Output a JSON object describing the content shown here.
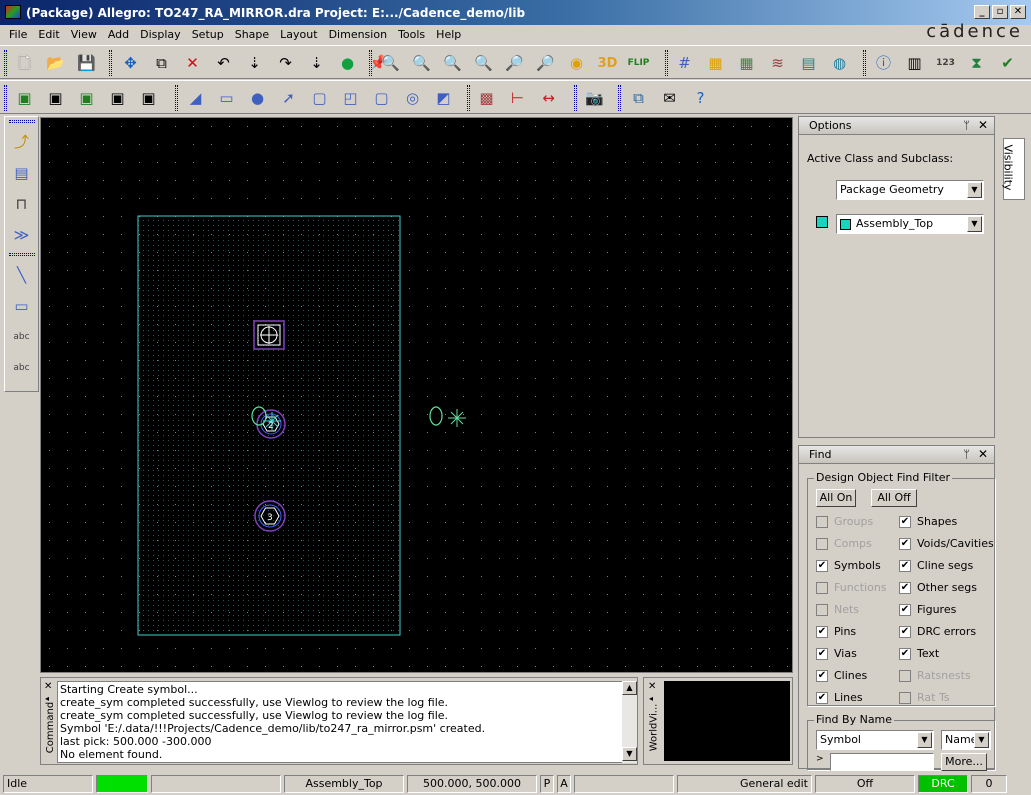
{
  "window": {
    "title": "(Package) Allegro: TO247_RA_MIRROR.dra  Project: E:.../Cadence_demo/lib"
  },
  "brand": "cādence",
  "menu": [
    "File",
    "Edit",
    "View",
    "Add",
    "Display",
    "Setup",
    "Shape",
    "Layout",
    "Dimension",
    "Tools",
    "Help"
  ],
  "canvas_labels": {
    "pin2": "2",
    "pin3": "3"
  },
  "command": {
    "label": "Command",
    "lines": [
      "Starting Create symbol...",
      "create_sym completed successfully, use Viewlog to review the log file.",
      "create_sym completed successfully, use Viewlog to review the log file.",
      "Symbol 'E:/.data/!!!Projects/Cadence_demo/lib/to247_ra_mirror.psm' created.",
      "last pick:  500.000  -300.000",
      "No element found."
    ]
  },
  "worldview": {
    "label": "WorldVi..."
  },
  "options": {
    "title": "Options",
    "active_label": "Active Class and Subclass:",
    "class_value": "Package Geometry",
    "subclass_value": "Assembly_Top",
    "visibility_tab": "Visibility"
  },
  "find": {
    "title": "Find",
    "filter_title": "Design Object Find Filter",
    "all_on": "All On",
    "all_off": "All Off",
    "left": [
      {
        "label": "Groups",
        "checked": false,
        "enabled": false
      },
      {
        "label": "Comps",
        "checked": false,
        "enabled": false
      },
      {
        "label": "Symbols",
        "checked": true,
        "enabled": true
      },
      {
        "label": "Functions",
        "checked": false,
        "enabled": false
      },
      {
        "label": "Nets",
        "checked": false,
        "enabled": false
      },
      {
        "label": "Pins",
        "checked": true,
        "enabled": true
      },
      {
        "label": "Vias",
        "checked": true,
        "enabled": true
      },
      {
        "label": "Clines",
        "checked": true,
        "enabled": true
      },
      {
        "label": "Lines",
        "checked": true,
        "enabled": true
      }
    ],
    "right": [
      {
        "label": "Shapes",
        "checked": true,
        "enabled": true
      },
      {
        "label": "Voids/Cavities",
        "checked": true,
        "enabled": true
      },
      {
        "label": "Cline segs",
        "checked": true,
        "enabled": true
      },
      {
        "label": "Other segs",
        "checked": true,
        "enabled": true
      },
      {
        "label": "Figures",
        "checked": true,
        "enabled": true
      },
      {
        "label": "DRC errors",
        "checked": true,
        "enabled": true
      },
      {
        "label": "Text",
        "checked": true,
        "enabled": true
      },
      {
        "label": "Ratsnests",
        "checked": false,
        "enabled": false
      },
      {
        "label": "Rat Ts",
        "checked": false,
        "enabled": false
      }
    ],
    "by_name_title": "Find By Name",
    "by_name_type": "Symbol",
    "by_name_mode": "Name",
    "more_button": "More..."
  },
  "status": {
    "state": "Idle",
    "subclass": "Assembly_Top",
    "coords": "500.000, 500.000",
    "p": "P",
    "a": "A",
    "mode": "General edit",
    "off": "Off",
    "drc": "DRC",
    "count": "0"
  },
  "colors": {
    "canvas": "#000000",
    "outline": "#40d0d0",
    "grid": "#5a7a7a",
    "drc": "#00c000",
    "idle_indicator": "#00e000"
  }
}
